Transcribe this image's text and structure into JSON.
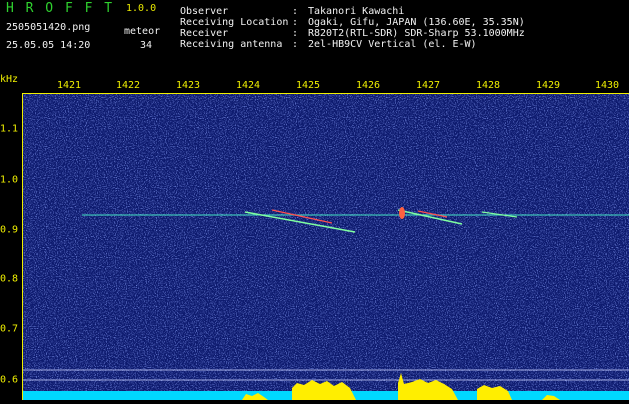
{
  "app": {
    "title": "H R O F F T",
    "version": "1.0.0"
  },
  "file": {
    "name": "2505051420.png",
    "datetime": "25.05.05 14:20"
  },
  "meteor": {
    "label": "meteor",
    "count": "34"
  },
  "info": [
    {
      "label": "Observer",
      "value": "Takanori Kawachi"
    },
    {
      "label": "Receiving Location",
      "value": "Ogaki, Gifu, JAPAN (136.60E, 35.35N)"
    },
    {
      "label": "Receiver",
      "value": "R820T2(RTL-SDR) SDR-Sharp 53.1000MHz"
    },
    {
      "label": "Receiving antenna",
      "value": "2el-HB9CV Vertical (el. E-W)"
    }
  ],
  "axis": {
    "y_unit": "kHz",
    "x_ticks": [
      "1421",
      "1422",
      "1423",
      "1424",
      "1425",
      "1426",
      "1427",
      "1428",
      "1429",
      "1430"
    ],
    "y_ticks": [
      "1.1",
      "1.0",
      "0.9",
      "0.8",
      "0.7",
      "0.6"
    ]
  },
  "colors": {
    "background": "#0d1a6e",
    "axis_text": "#f0f000",
    "title": "#2fd12f",
    "carrier": "#48e8c8",
    "meteor_hot": "#ff4040",
    "signal_bar": "#ffee00",
    "baseline_bar": "#00d8ff"
  }
}
